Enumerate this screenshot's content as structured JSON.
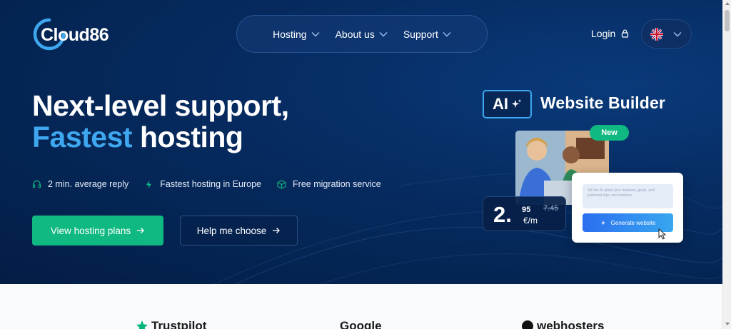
{
  "brand": {
    "logo_text": "Cloud86"
  },
  "nav": {
    "items": [
      {
        "label": "Hosting"
      },
      {
        "label": "About us"
      },
      {
        "label": "Support"
      }
    ],
    "login_label": "Login"
  },
  "hero": {
    "headline_line1": "Next-level support,",
    "headline_accent": "Fastest",
    "headline_rest": " hosting",
    "features": [
      {
        "icon": "headset-icon",
        "label": "2 min. average reply"
      },
      {
        "icon": "lightning-icon",
        "label": "Fastest hosting in Europe"
      },
      {
        "icon": "box-icon",
        "label": "Free migration service"
      }
    ],
    "primary_button": "View hosting plans",
    "secondary_button": "Help me choose"
  },
  "promo": {
    "ai_badge": "AI",
    "title": "Website Builder",
    "new_badge": "New",
    "input_placeholder": "Tell the AI about your business, goals, and preferred style and continue.",
    "generate_button": "Generate website",
    "price_main": "2.",
    "price_decimals": "95",
    "price_old": "7.45",
    "price_unit": "€/m"
  },
  "reviews": {
    "items": [
      {
        "label": "Trustpilot"
      },
      {
        "label": "Google"
      },
      {
        "label": "webhosters"
      }
    ]
  },
  "colors": {
    "accent": "#3ea7ef",
    "primary_green": "#10b981",
    "hero_bg": "#062c62"
  }
}
